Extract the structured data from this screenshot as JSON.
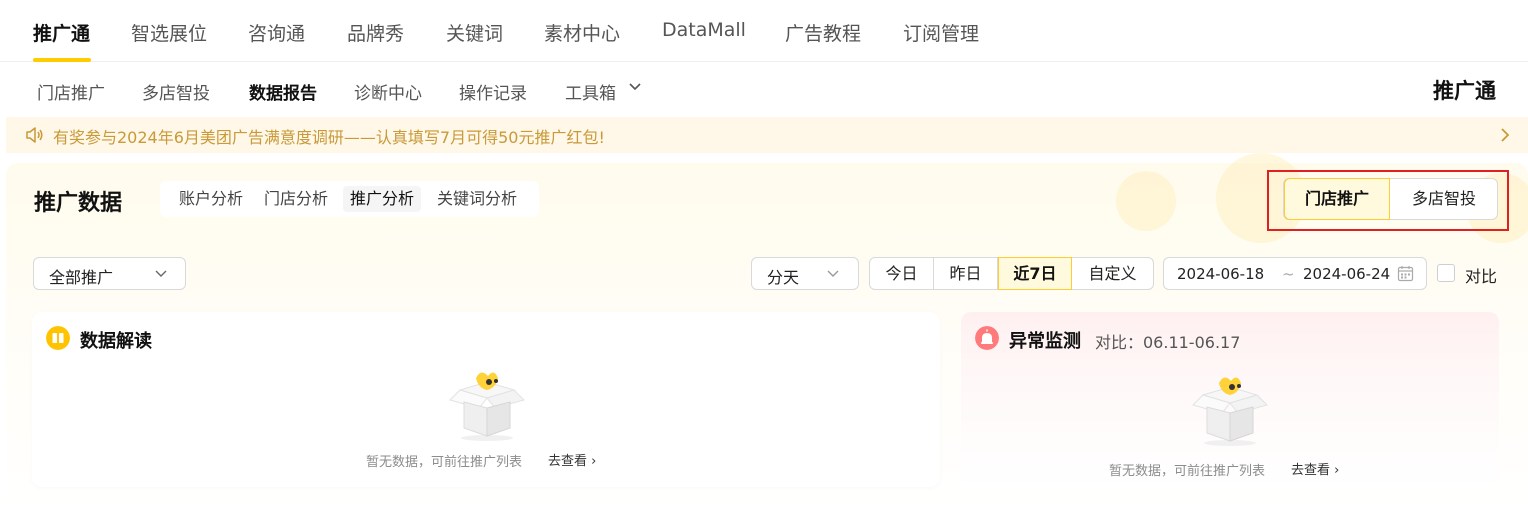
{
  "top_nav": {
    "items": [
      "推广通",
      "智选展位",
      "咨询通",
      "品牌秀",
      "关键词",
      "素材中心",
      "DataMall",
      "广告教程",
      "订阅管理"
    ],
    "active_index": 0
  },
  "sub_nav": {
    "items": [
      "门店推广",
      "多店智投",
      "数据报告",
      "诊断中心",
      "操作记录",
      "工具箱"
    ],
    "active_index": 2,
    "brand": "推广通"
  },
  "banner": {
    "text": "有奖参与2024年6月美团广告满意度调研——认真填写7月可得50元推广红包!"
  },
  "page": {
    "title": "推广数据",
    "tabs": [
      "账户分析",
      "门店分析",
      "推广分析",
      "关键词分析"
    ],
    "active_tab": 2,
    "scope_toggle": [
      "门店推广",
      "多店智投"
    ],
    "scope_active": 0
  },
  "filters": {
    "promotion_select": "全部推广",
    "granularity_select": "分天",
    "day_buttons": [
      "今日",
      "昨日",
      "近7日",
      "自定义"
    ],
    "day_active": 2,
    "date_start": "2024-06-18",
    "date_sep": "~",
    "date_end": "2024-06-24",
    "compare_label": "对比"
  },
  "cards": {
    "insight": {
      "title": "数据解读",
      "empty_text": "暂无数据，可前往推广列表",
      "link": "去查看 ›"
    },
    "anomaly": {
      "title": "异常监测",
      "compare_text": "对比：06.11-06.17",
      "empty_text": "暂无数据，可前往推广列表",
      "link": "去查看 ›"
    }
  },
  "colors": {
    "accent": "#ffcc00",
    "banner_text": "#c89a38",
    "highlight_outline": "#e02020"
  },
  "icons": [
    "chevron-down-icon",
    "speaker-icon",
    "chevron-right-icon",
    "calendar-icon",
    "book-icon",
    "alarm-icon",
    "empty-box-icon"
  ]
}
